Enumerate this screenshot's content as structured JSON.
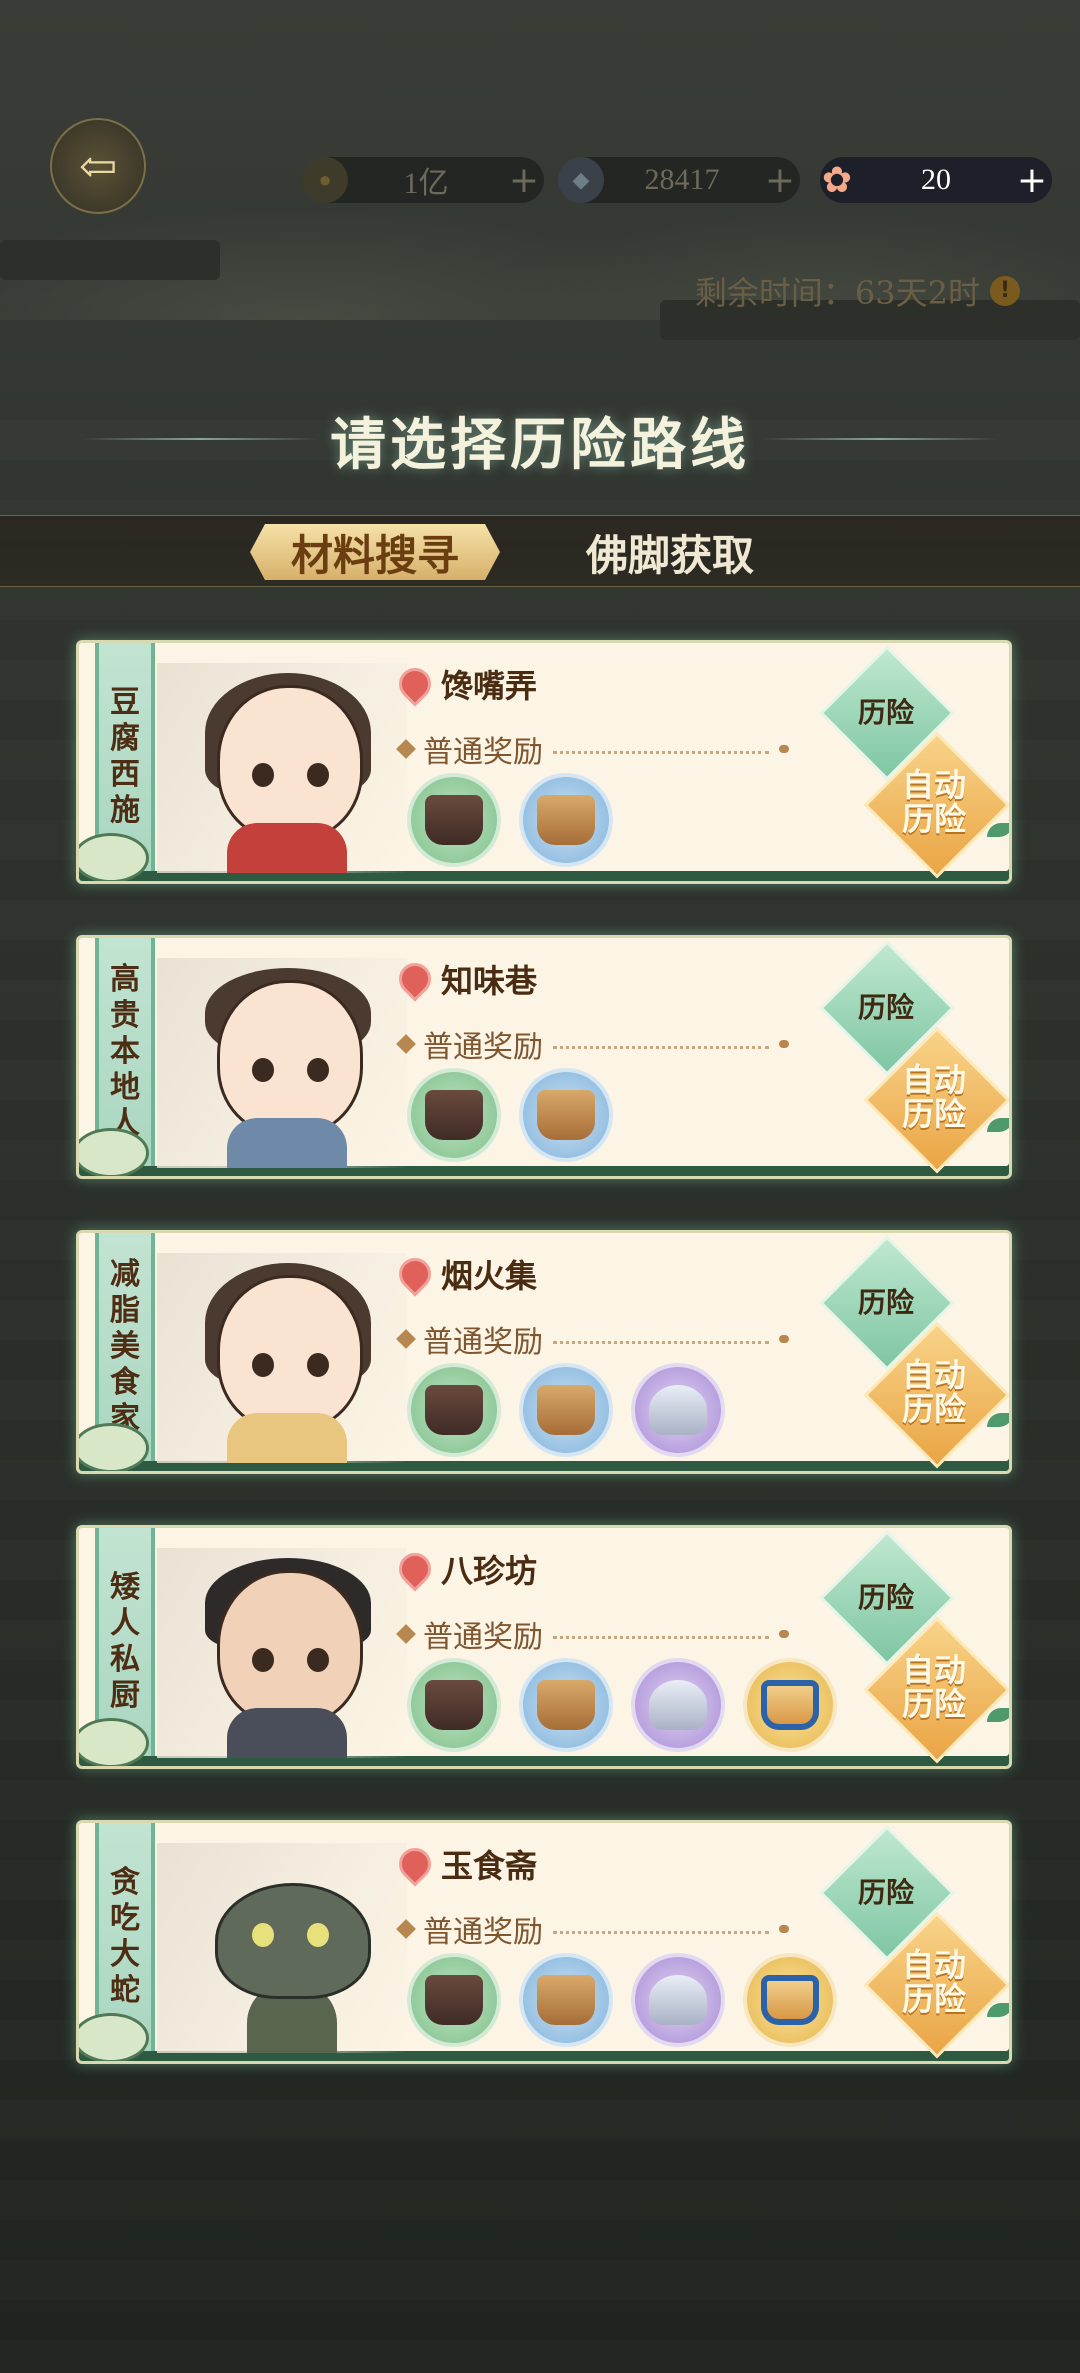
{
  "top_bar": {
    "resources": [
      {
        "icon": "coin-icon",
        "value": "1亿"
      },
      {
        "icon": "gem-icon",
        "value": "28417"
      },
      {
        "icon": "ticket-icon",
        "value": "20"
      }
    ],
    "plus": "+",
    "timer": "剩余时间：63天2时",
    "timer_warn": "!"
  },
  "header": {
    "title": "请选择历险路线"
  },
  "tabs": [
    {
      "label": "材料搜寻",
      "active": true
    },
    {
      "label": "佛脚获取",
      "active": false
    }
  ],
  "reward_label": "普通奖励",
  "buttons": {
    "adventure": "历险",
    "auto_line1": "自动",
    "auto_line2": "历险"
  },
  "routes": [
    {
      "character": [
        "豆",
        "腐",
        "西",
        "施"
      ],
      "location": "馋嘴弄",
      "items": [
        "green-dark-pot",
        "blue-tan-pot"
      ]
    },
    {
      "character": [
        "高",
        "贵",
        "本",
        "地",
        "人"
      ],
      "location": "知味巷",
      "items": [
        "green-dark-pot",
        "blue-tan-pot"
      ]
    },
    {
      "character": [
        "减",
        "脂",
        "美",
        "食",
        "家"
      ],
      "location": "烟火集",
      "items": [
        "green-dark-pot",
        "blue-tan-pot",
        "purple-glass-pot"
      ]
    },
    {
      "character": [
        "矮",
        "人",
        "私",
        "厨"
      ],
      "location": "八珍坊",
      "items": [
        "green-dark-pot",
        "blue-tan-pot",
        "purple-glass-pot",
        "gold-ornate-pot"
      ]
    },
    {
      "character": [
        "贪",
        "吃",
        "大",
        "蛇"
      ],
      "location": "玉食斋",
      "items": [
        "green-dark-pot",
        "blue-tan-pot",
        "purple-glass-pot",
        "gold-ornate-pot"
      ]
    }
  ]
}
